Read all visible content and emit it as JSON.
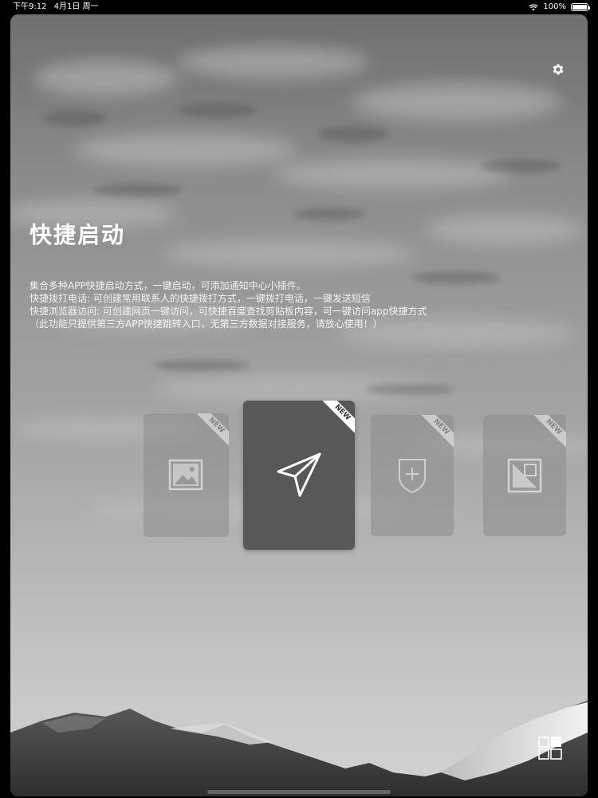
{
  "status_bar": {
    "time": "下午9:12",
    "date": "4月1日 周一",
    "battery": "100%",
    "wifi_icon": "wifi-icon",
    "battery_icon": "battery-icon"
  },
  "header": {
    "title": "快捷启动",
    "settings_icon": "gear-icon"
  },
  "description": {
    "lines": [
      "集合多种APP快捷启动方式，一键启动，可添加通知中心小插件。",
      "快捷拨打电话: 可创建常用联系人的快捷拨打方式，一键拨打电话，一键发送短信",
      "快捷浏览器访问: 可创建网页一键访问，可快捷百度查找剪贴板内容，可一键访问app快捷方式",
      "（此功能只提供第三方APP快捷跳转入口，无第三方数据对接服务，请放心使用！）"
    ]
  },
  "cards": [
    {
      "icon": "image-icon",
      "badge": "NEW"
    },
    {
      "icon": "paper-plane-icon",
      "badge": "NEW"
    },
    {
      "icon": "shield-plus-icon",
      "badge": "NEW"
    },
    {
      "icon": "photo-frame-icon",
      "badge": "NEW"
    }
  ],
  "bottom": {
    "grid_icon": "grid-icon"
  },
  "colors": {
    "active_card": "#585858",
    "text": "#ffffff"
  }
}
